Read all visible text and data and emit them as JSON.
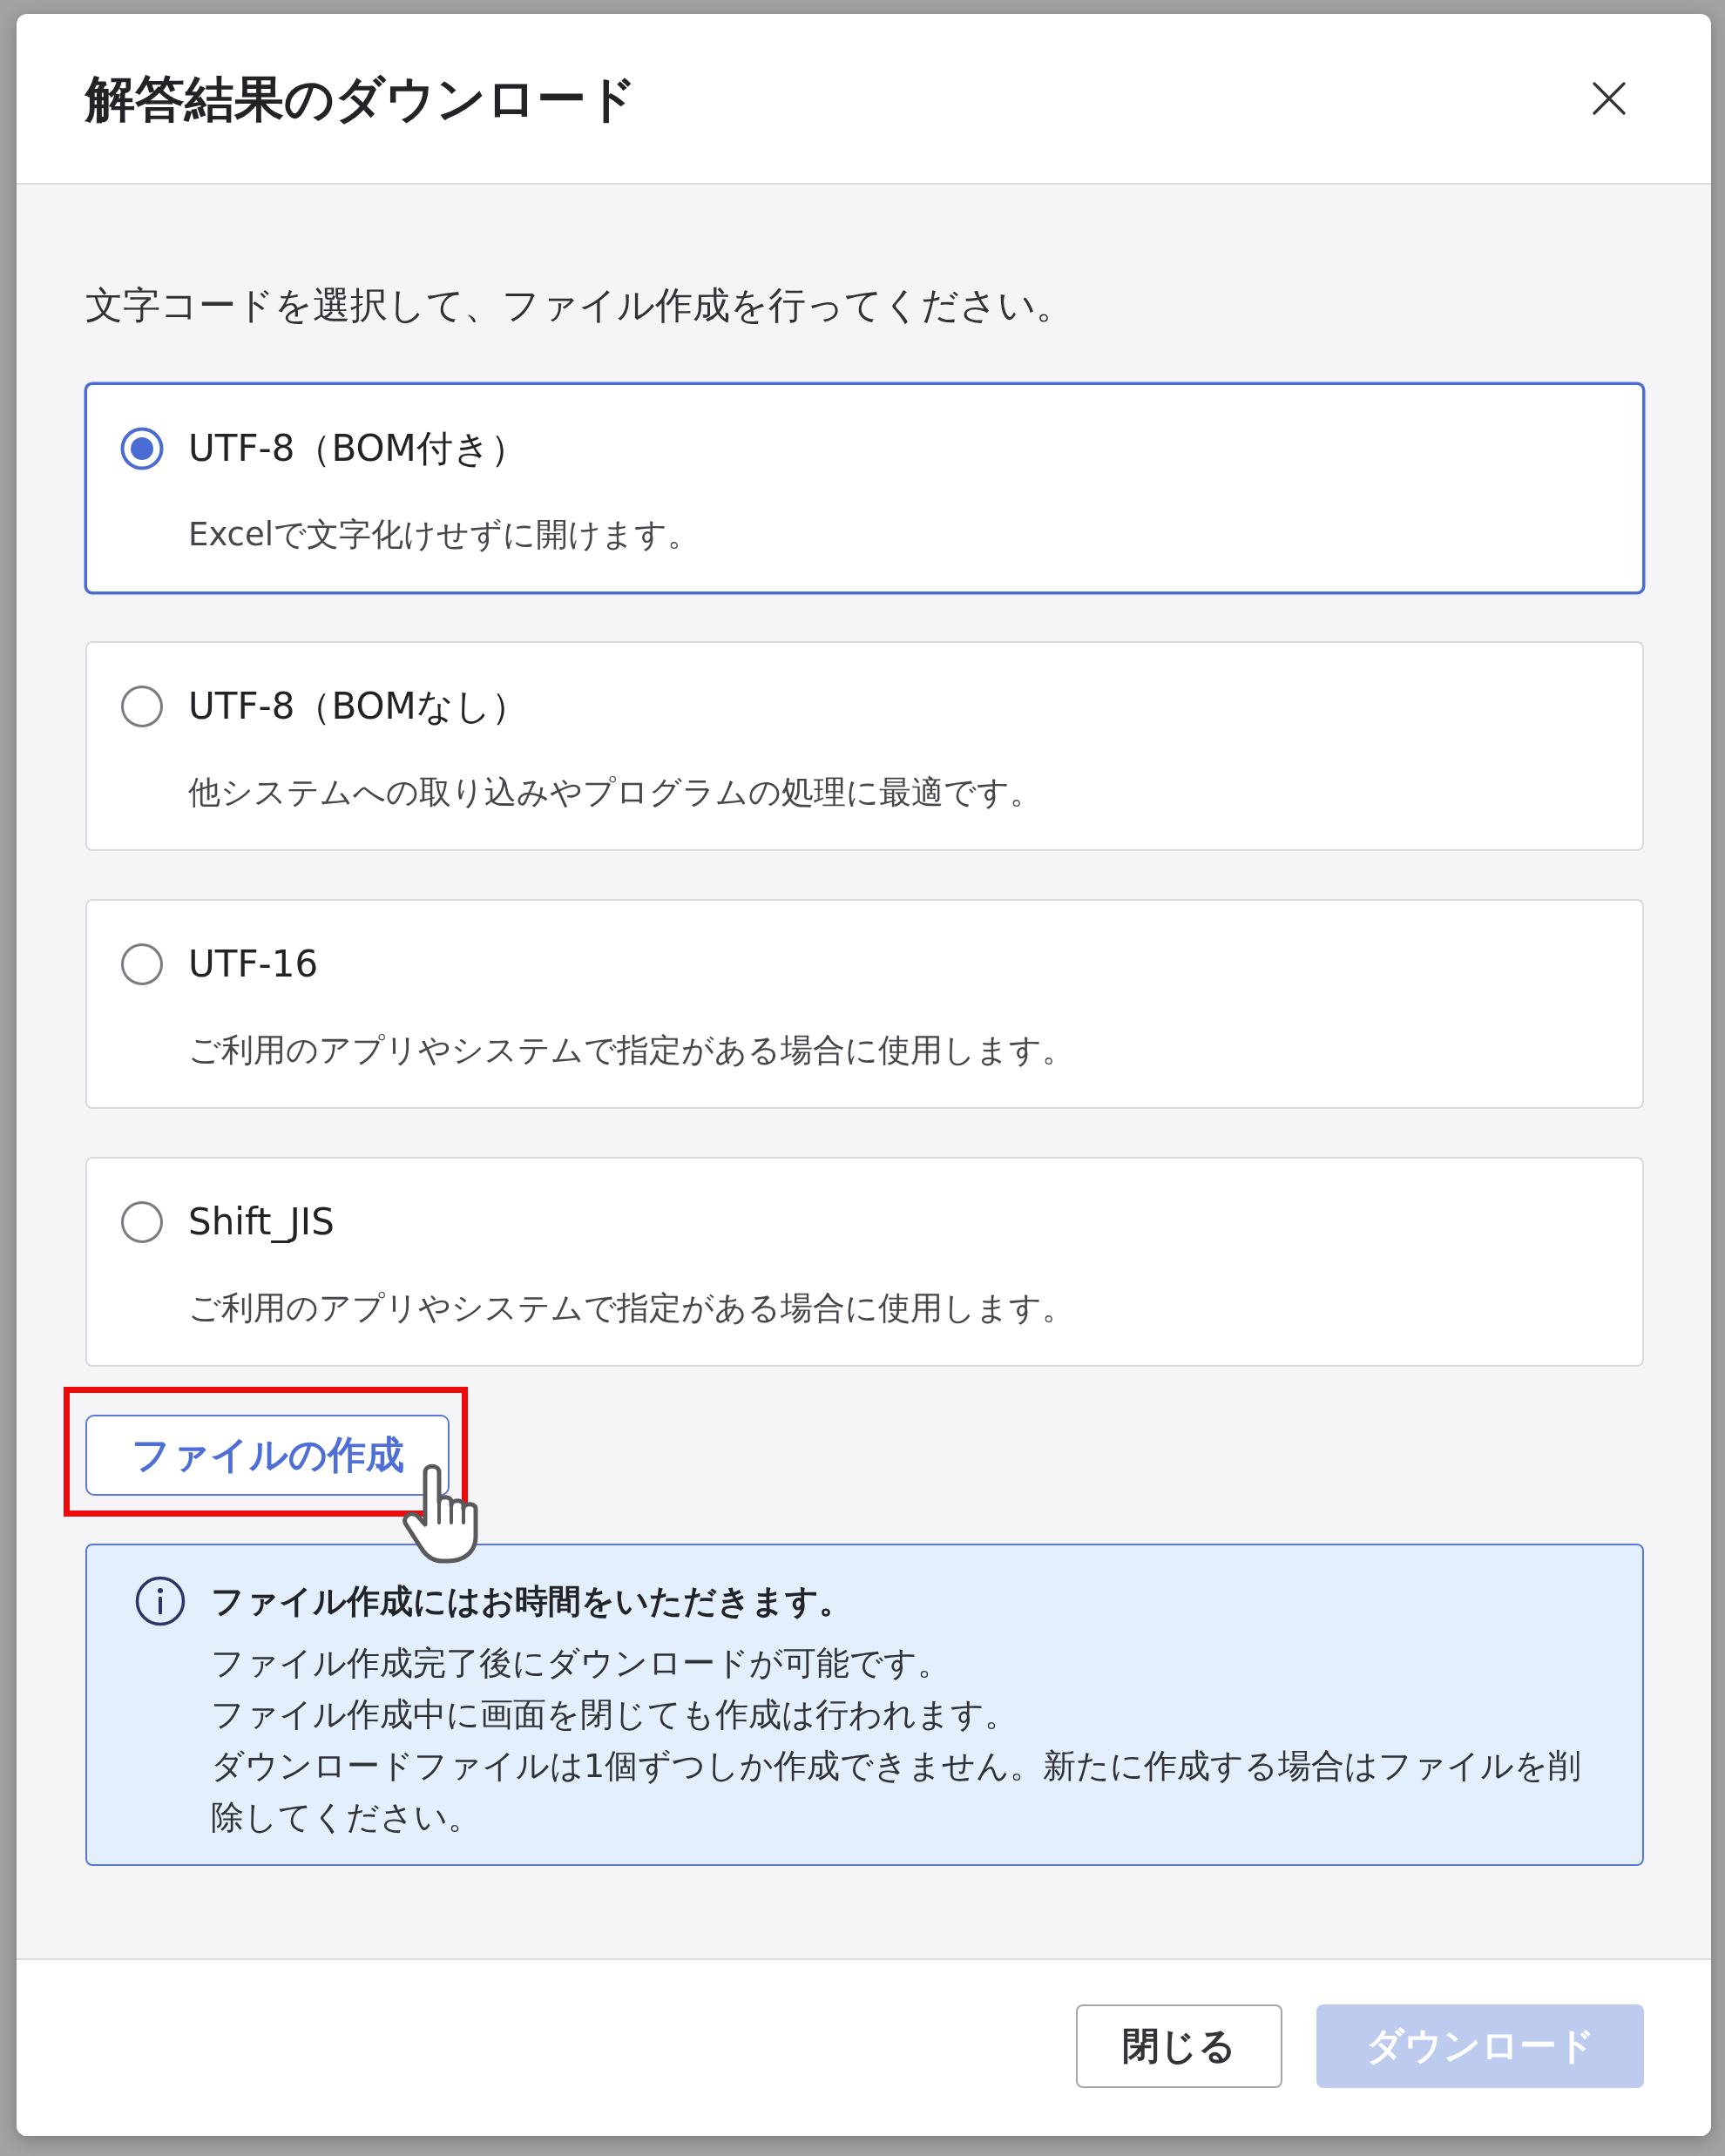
{
  "dialog": {
    "title": "解答結果のダウンロード"
  },
  "instruction": "文字コードを選択して、ファイル作成を行ってください。",
  "encodings": [
    {
      "label": "UTF-8（BOM付き）",
      "description": "Excelで文字化けせずに開けます。",
      "selected": true
    },
    {
      "label": "UTF-8（BOMなし）",
      "description": "他システムへの取り込みやプログラムの処理に最適です。",
      "selected": false
    },
    {
      "label": "UTF-16",
      "description": "ご利用のアプリやシステムで指定がある場合に使用します。",
      "selected": false
    },
    {
      "label": "Shift_JIS",
      "description": "ご利用のアプリやシステムで指定がある場合に使用します。",
      "selected": false
    }
  ],
  "create_button": {
    "label": "ファイルの作成",
    "highlighted": true,
    "hovered": true
  },
  "notice": {
    "heading": "ファイル作成にはお時間をいただきます。",
    "lines": [
      "ファイル作成完了後にダウンロードが可能です。",
      "ファイル作成中に画面を閉じても作成は行われます。",
      "ダウンロードファイルは1個ずつしか作成できません。新たに作成する場合はファイルを削除してください。"
    ]
  },
  "footer_buttons": [
    {
      "label": "閉じる",
      "kind": "secondary",
      "disabled": false
    },
    {
      "label": "ダウンロード",
      "kind": "primary",
      "disabled": true
    }
  ]
}
